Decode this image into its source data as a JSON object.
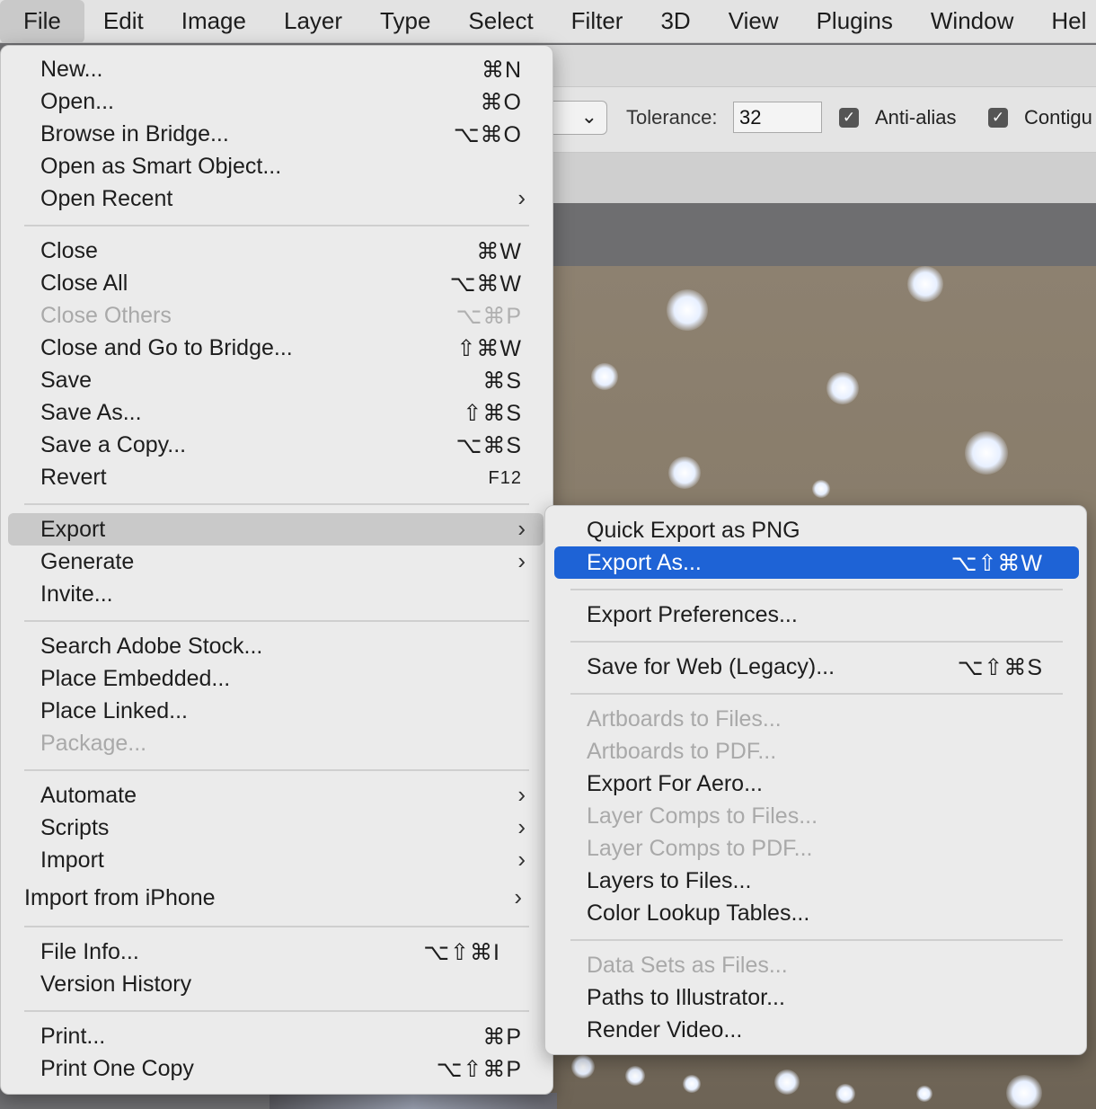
{
  "menubar": {
    "items": [
      "File",
      "Edit",
      "Image",
      "Layer",
      "Type",
      "Select",
      "Filter",
      "3D",
      "View",
      "Plugins",
      "Window",
      "Hel"
    ],
    "active_index": 0
  },
  "options": {
    "tolerance_label": "Tolerance:",
    "tolerance_value": "32",
    "anti_alias_label": "Anti-alias",
    "anti_alias_checked": true,
    "contiguous_label": "Contigu",
    "contiguous_checked": true,
    "check_glyph": "✓",
    "chevron_glyph": "⌄"
  },
  "file_menu": {
    "items": [
      {
        "label": "New...",
        "shortcut": "⌘N"
      },
      {
        "label": "Open...",
        "shortcut": "⌘O"
      },
      {
        "label": "Browse in Bridge...",
        "shortcut": "⌥⌘O"
      },
      {
        "label": "Open as Smart Object...",
        "shortcut": ""
      },
      {
        "label": "Open Recent",
        "shortcut": "",
        "submenu": true
      },
      {
        "label": "Close",
        "shortcut": "⌘W"
      },
      {
        "label": "Close All",
        "shortcut": "⌥⌘W"
      },
      {
        "label": "Close Others",
        "shortcut": "⌥⌘P",
        "disabled": true
      },
      {
        "label": "Close and Go to Bridge...",
        "shortcut": "⇧⌘W"
      },
      {
        "label": "Save",
        "shortcut": "⌘S"
      },
      {
        "label": "Save As...",
        "shortcut": "⇧⌘S"
      },
      {
        "label": "Save a Copy...",
        "shortcut": "⌥⌘S"
      },
      {
        "label": "Revert",
        "shortcut": "F12"
      },
      {
        "label": "Export",
        "shortcut": "",
        "submenu": true,
        "highlighted": true
      },
      {
        "label": "Generate",
        "shortcut": "",
        "submenu": true
      },
      {
        "label": "Invite...",
        "shortcut": ""
      },
      {
        "label": "Search Adobe Stock...",
        "shortcut": ""
      },
      {
        "label": "Place Embedded...",
        "shortcut": ""
      },
      {
        "label": "Place Linked...",
        "shortcut": ""
      },
      {
        "label": "Package...",
        "shortcut": "",
        "disabled": true
      },
      {
        "label": "Automate",
        "shortcut": "",
        "submenu": true
      },
      {
        "label": "Scripts",
        "shortcut": "",
        "submenu": true
      },
      {
        "label": "Import",
        "shortcut": "",
        "submenu": true
      },
      {
        "label": "Import from iPhone",
        "shortcut": "",
        "submenu": true
      },
      {
        "label": "File Info...",
        "shortcut": "⌥⇧⌘I"
      },
      {
        "label": "Version History",
        "shortcut": ""
      },
      {
        "label": "Print...",
        "shortcut": "⌘P"
      },
      {
        "label": "Print One Copy",
        "shortcut": "⌥⇧⌘P"
      }
    ]
  },
  "export_menu": {
    "items": [
      {
        "label": "Quick Export as PNG",
        "shortcut": ""
      },
      {
        "label": "Export As...",
        "shortcut": "⌥⇧⌘W",
        "selected": true
      },
      {
        "label": "Export Preferences...",
        "shortcut": ""
      },
      {
        "label": "Save for Web (Legacy)...",
        "shortcut": "⌥⇧⌘S"
      },
      {
        "label": "Artboards to Files...",
        "shortcut": "",
        "disabled": true
      },
      {
        "label": "Artboards to PDF...",
        "shortcut": "",
        "disabled": true
      },
      {
        "label": "Export For Aero...",
        "shortcut": ""
      },
      {
        "label": "Layer Comps to Files...",
        "shortcut": "",
        "disabled": true
      },
      {
        "label": "Layer Comps to PDF...",
        "shortcut": "",
        "disabled": true
      },
      {
        "label": "Layers to Files...",
        "shortcut": ""
      },
      {
        "label": "Color Lookup Tables...",
        "shortcut": ""
      },
      {
        "label": "Data Sets as Files...",
        "shortcut": "",
        "disabled": true
      },
      {
        "label": "Paths to Illustrator...",
        "shortcut": ""
      },
      {
        "label": "Render Video...",
        "shortcut": ""
      }
    ]
  },
  "colors": {
    "selection_blue": "#1e63d6",
    "menu_bg": "#ebebeb",
    "disabled_text": "#a9a9a9"
  },
  "submenu_arrow_glyph": "›"
}
